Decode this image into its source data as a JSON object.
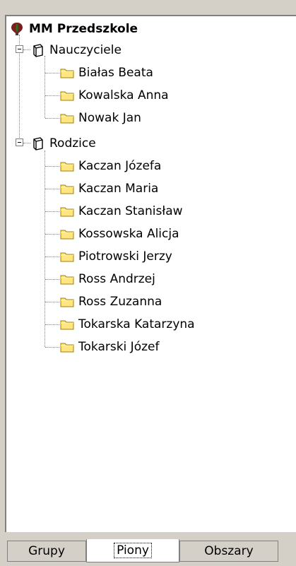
{
  "tree": {
    "root": {
      "label": "MM Przedszkole"
    },
    "groups": [
      {
        "label": "Nauczyciele",
        "items": [
          "Białas Beata",
          "Kowalska Anna",
          "Nowak Jan"
        ]
      },
      {
        "label": "Rodzice",
        "items": [
          "Kaczan Józefa",
          "Kaczan Maria",
          "Kaczan Stanisław",
          "Kossowska Alicja",
          "Piotrowski Jerzy",
          "Ross Andrzej",
          "Ross Zuzanna",
          "Tokarska Katarzyna",
          "Tokarski Józef"
        ]
      }
    ]
  },
  "tabs": [
    {
      "label": "Grupy",
      "active": false
    },
    {
      "label": "Piony",
      "active": true
    },
    {
      "label": "Obszary",
      "active": false
    }
  ],
  "colors": {
    "folder": "#ffe680",
    "root_icon": "#7a1f1f",
    "root_icon_leaf": "#1f7a1f"
  }
}
